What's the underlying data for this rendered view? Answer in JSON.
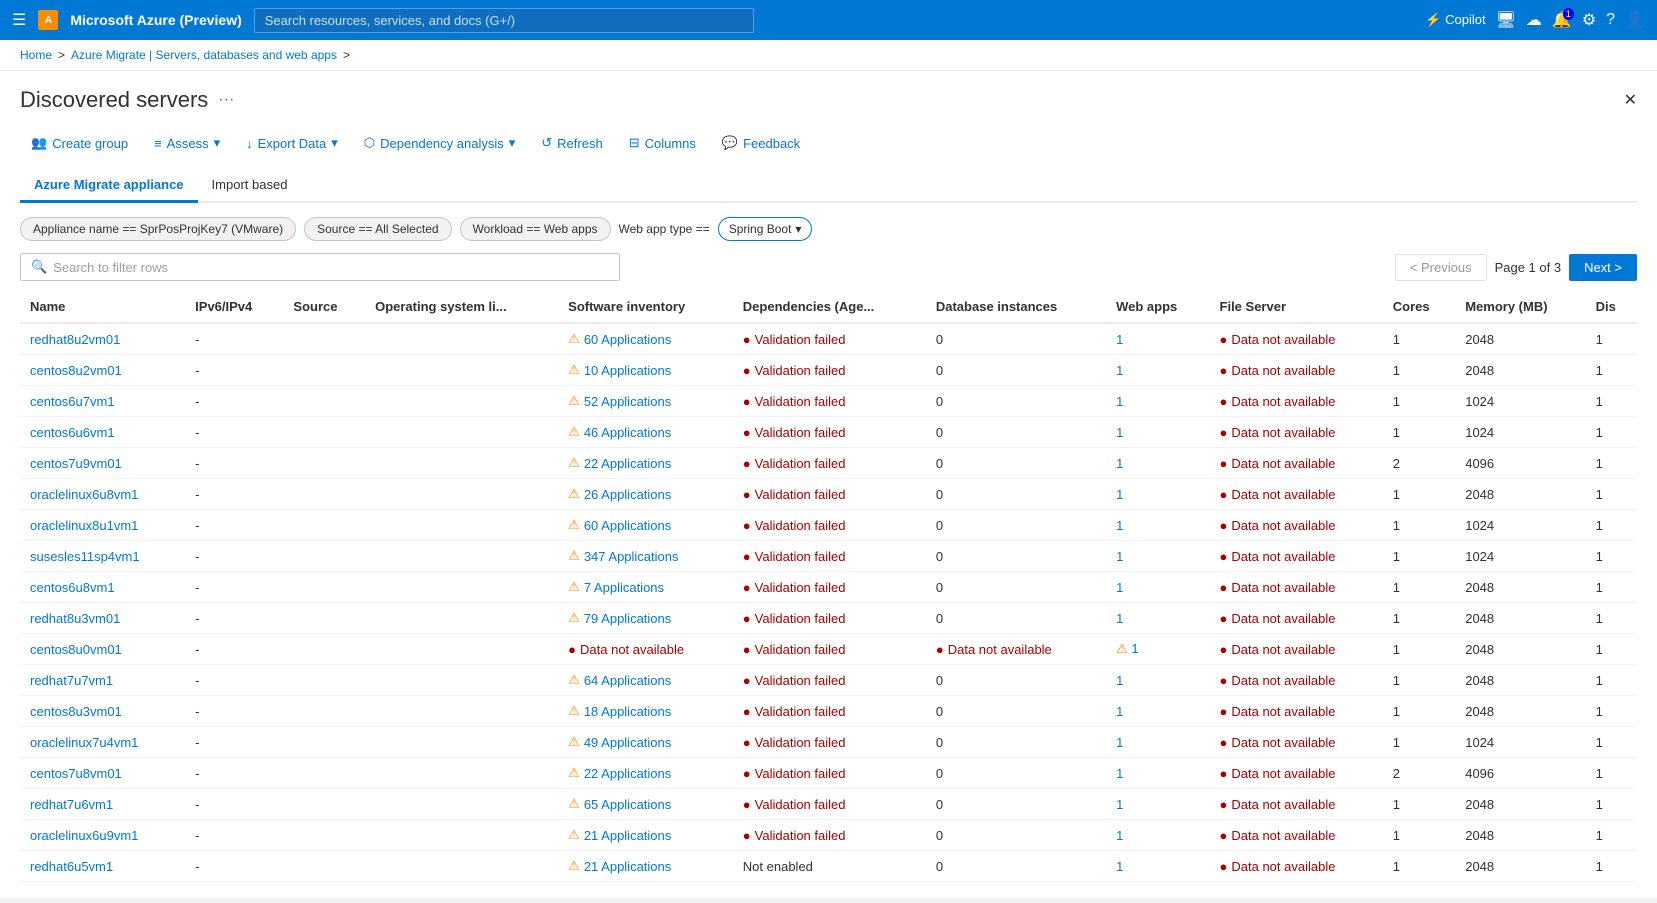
{
  "topNav": {
    "hamburger": "☰",
    "title": "Microsoft Azure (Preview)",
    "searchPlaceholder": "Search resources, services, and docs (G+/)",
    "copilotLabel": "Copilot",
    "icons": [
      "monitor-icon",
      "cloud-upload-icon",
      "bell-icon",
      "gear-icon",
      "help-icon",
      "user-icon"
    ]
  },
  "breadcrumb": {
    "items": [
      "Home",
      "Azure Migrate | Servers, databases and web apps"
    ]
  },
  "pageTitle": "Discovered servers",
  "pageMoreLabel": "···",
  "closeLabel": "✕",
  "toolbar": {
    "createGroup": "Create group",
    "assess": "Assess",
    "exportData": "Export Data",
    "dependencyAnalysis": "Dependency analysis",
    "refresh": "Refresh",
    "columns": "Columns",
    "feedback": "Feedback"
  },
  "tabs": [
    {
      "label": "Azure Migrate appliance",
      "active": true
    },
    {
      "label": "Import based",
      "active": false
    }
  ],
  "filters": [
    {
      "label": "Appliance name == SprPosProjKey7 (VMware)",
      "type": "pill"
    },
    {
      "label": "Source == All Selected",
      "type": "pill"
    },
    {
      "label": "Workload == Web apps",
      "type": "pill"
    },
    {
      "label": "Web app type ==",
      "type": "label"
    },
    {
      "label": "Spring Boot",
      "type": "dropdown"
    }
  ],
  "search": {
    "placeholder": "Search to filter rows"
  },
  "pagination": {
    "previousLabel": "< Previous",
    "pageLabel": "Page 1 of 3",
    "nextLabel": "Next >"
  },
  "columns": [
    "Name",
    "IPv6/IPv4",
    "Source",
    "Operating system li...",
    "Software inventory",
    "Dependencies (Age...",
    "Database instances",
    "Web apps",
    "File Server",
    "Cores",
    "Memory (MB)",
    "Dis"
  ],
  "rows": [
    {
      "name": "redhat8u2vm01",
      "ipv6": "-",
      "source": "",
      "osLic": "",
      "softwareInv": {
        "type": "warn",
        "count": "60",
        "label": "Applications"
      },
      "dependencies": {
        "type": "error",
        "label": "Validation failed"
      },
      "dbInstances": "0",
      "webApps": "1",
      "fileServer": "Data not available",
      "cores": "1",
      "memory": "2048",
      "dis": "1"
    },
    {
      "name": "centos8u2vm01",
      "ipv6": "-",
      "source": "",
      "osLic": "",
      "softwareInv": {
        "type": "warn",
        "count": "10",
        "label": "Applications"
      },
      "dependencies": {
        "type": "error",
        "label": "Validation failed"
      },
      "dbInstances": "0",
      "webApps": "1",
      "fileServer": "Data not available",
      "cores": "1",
      "memory": "2048",
      "dis": "1"
    },
    {
      "name": "centos6u7vm1",
      "ipv6": "-",
      "source": "",
      "osLic": "",
      "softwareInv": {
        "type": "warn",
        "count": "52",
        "label": "Applications"
      },
      "dependencies": {
        "type": "error",
        "label": "Validation failed"
      },
      "dbInstances": "0",
      "webApps": "1",
      "fileServer": "Data not available",
      "cores": "1",
      "memory": "1024",
      "dis": "1"
    },
    {
      "name": "centos6u6vm1",
      "ipv6": "-",
      "source": "",
      "osLic": "",
      "softwareInv": {
        "type": "warn",
        "count": "46",
        "label": "Applications"
      },
      "dependencies": {
        "type": "error",
        "label": "Validation failed"
      },
      "dbInstances": "0",
      "webApps": "1",
      "fileServer": "Data not available",
      "cores": "1",
      "memory": "1024",
      "dis": "1"
    },
    {
      "name": "centos7u9vm01",
      "ipv6": "-",
      "source": "",
      "osLic": "",
      "softwareInv": {
        "type": "warn",
        "count": "22",
        "label": "Applications"
      },
      "dependencies": {
        "type": "error",
        "label": "Validation failed"
      },
      "dbInstances": "0",
      "webApps": "1",
      "fileServer": "Data not available",
      "cores": "2",
      "memory": "4096",
      "dis": "1"
    },
    {
      "name": "oraclelinux6u8vm1",
      "ipv6": "-",
      "source": "",
      "osLic": "",
      "softwareInv": {
        "type": "warn",
        "count": "26",
        "label": "Applications"
      },
      "dependencies": {
        "type": "error",
        "label": "Validation failed"
      },
      "dbInstances": "0",
      "webApps": "1",
      "fileServer": "Data not available",
      "cores": "1",
      "memory": "2048",
      "dis": "1"
    },
    {
      "name": "oraclelinux8u1vm1",
      "ipv6": "-",
      "source": "",
      "osLic": "",
      "softwareInv": {
        "type": "warn",
        "count": "60",
        "label": "Applications"
      },
      "dependencies": {
        "type": "error",
        "label": "Validation failed"
      },
      "dbInstances": "0",
      "webApps": "1",
      "fileServer": "Data not available",
      "cores": "1",
      "memory": "1024",
      "dis": "1"
    },
    {
      "name": "susesles11sp4vm1",
      "ipv6": "-",
      "source": "",
      "osLic": "",
      "softwareInv": {
        "type": "warn",
        "count": "347",
        "label": "Applications"
      },
      "dependencies": {
        "type": "error",
        "label": "Validation failed"
      },
      "dbInstances": "0",
      "webApps": "1",
      "fileServer": "Data not available",
      "cores": "1",
      "memory": "1024",
      "dis": "1"
    },
    {
      "name": "centos6u8vm1",
      "ipv6": "-",
      "source": "",
      "osLic": "",
      "softwareInv": {
        "type": "warn",
        "count": "7",
        "label": "Applications"
      },
      "dependencies": {
        "type": "error",
        "label": "Validation failed"
      },
      "dbInstances": "0",
      "webApps": "1",
      "fileServer": "Data not available",
      "cores": "1",
      "memory": "2048",
      "dis": "1"
    },
    {
      "name": "redhat8u3vm01",
      "ipv6": "-",
      "source": "",
      "osLic": "",
      "softwareInv": {
        "type": "warn",
        "count": "79",
        "label": "Applications"
      },
      "dependencies": {
        "type": "error",
        "label": "Validation failed"
      },
      "dbInstances": "0",
      "webApps": "1",
      "fileServer": "Data not available",
      "cores": "1",
      "memory": "2048",
      "dis": "1"
    },
    {
      "name": "centos8u0vm01",
      "ipv6": "-",
      "source": "",
      "osLic": "",
      "softwareInv": {
        "type": "error-na",
        "label": "Data not available"
      },
      "dependencies": {
        "type": "error",
        "label": "Validation failed"
      },
      "dbInstances": "0",
      "webApps": "1",
      "fileServer": "Data not available",
      "dbInstancesSpecial": "Data not available",
      "webAppsSpecial": "1",
      "cores": "1",
      "memory": "2048",
      "dis": "1",
      "special": true
    },
    {
      "name": "redhat7u7vm1",
      "ipv6": "-",
      "source": "",
      "osLic": "",
      "softwareInv": {
        "type": "warn",
        "count": "64",
        "label": "Applications"
      },
      "dependencies": {
        "type": "error",
        "label": "Validation failed"
      },
      "dbInstances": "0",
      "webApps": "1",
      "fileServer": "Data not available",
      "cores": "1",
      "memory": "2048",
      "dis": "1"
    },
    {
      "name": "centos8u3vm01",
      "ipv6": "-",
      "source": "",
      "osLic": "",
      "softwareInv": {
        "type": "warn",
        "count": "18",
        "label": "Applications"
      },
      "dependencies": {
        "type": "error",
        "label": "Validation failed"
      },
      "dbInstances": "0",
      "webApps": "1",
      "fileServer": "Data not available",
      "cores": "1",
      "memory": "2048",
      "dis": "1"
    },
    {
      "name": "oraclelinux7u4vm1",
      "ipv6": "-",
      "source": "",
      "osLic": "",
      "softwareInv": {
        "type": "warn",
        "count": "49",
        "label": "Applications"
      },
      "dependencies": {
        "type": "error",
        "label": "Validation failed"
      },
      "dbInstances": "0",
      "webApps": "1",
      "fileServer": "Data not available",
      "cores": "1",
      "memory": "1024",
      "dis": "1"
    },
    {
      "name": "centos7u8vm01",
      "ipv6": "-",
      "source": "",
      "osLic": "",
      "softwareInv": {
        "type": "warn",
        "count": "22",
        "label": "Applications"
      },
      "dependencies": {
        "type": "error",
        "label": "Validation failed"
      },
      "dbInstances": "0",
      "webApps": "1",
      "fileServer": "Data not available",
      "cores": "2",
      "memory": "4096",
      "dis": "1"
    },
    {
      "name": "redhat7u6vm1",
      "ipv6": "-",
      "source": "",
      "osLic": "",
      "softwareInv": {
        "type": "warn",
        "count": "65",
        "label": "Applications"
      },
      "dependencies": {
        "type": "error",
        "label": "Validation failed"
      },
      "dbInstances": "0",
      "webApps": "1",
      "fileServer": "Data not available",
      "cores": "1",
      "memory": "2048",
      "dis": "1"
    },
    {
      "name": "oraclelinux6u9vm1",
      "ipv6": "-",
      "source": "",
      "osLic": "",
      "softwareInv": {
        "type": "warn",
        "count": "21",
        "label": "Applications"
      },
      "dependencies": {
        "type": "error",
        "label": "Validation failed"
      },
      "dbInstances": "0",
      "webApps": "1",
      "fileServer": "Data not available",
      "cores": "1",
      "memory": "2048",
      "dis": "1"
    },
    {
      "name": "redhat6u5vm1",
      "ipv6": "-",
      "source": "",
      "osLic": "",
      "softwareInv": {
        "type": "warn",
        "count": "21",
        "label": "Applications"
      },
      "dependencies": {
        "type": "not-enabled",
        "label": "Not enabled"
      },
      "dbInstances": "0",
      "webApps": "1",
      "fileServer": "Data not available",
      "cores": "1",
      "memory": "2048",
      "dis": "1"
    }
  ]
}
